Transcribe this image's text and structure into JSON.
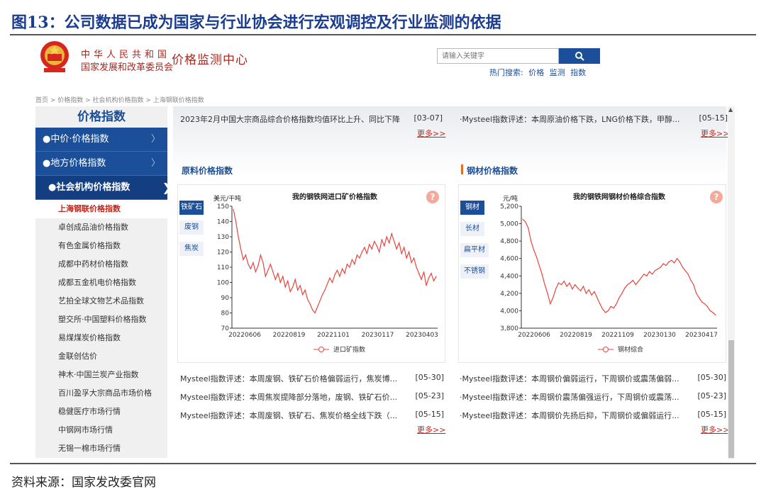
{
  "figure": {
    "title": "图13：公司数据已成为国家与行业协会进行宏观调控及行业监测的依据",
    "source": "资料来源：国家发改委官网"
  },
  "header": {
    "org_line1": "中华人民共和国",
    "org_line2": "国家发展和改革委员会",
    "center_name": "价格监测中心",
    "search_placeholder": "请输入关键字",
    "hot_label": "热门搜索:",
    "hot_terms": [
      "价格",
      "监测",
      "指数"
    ]
  },
  "breadcrumb": "首页 > 价格指数 > 社会机构价格指数 > 上海钢联价格指数",
  "sidebar": {
    "title": "价格指数",
    "sections": [
      "●中价·价格指数",
      "●地方价格指数",
      "●社会机构价格指数"
    ],
    "items": [
      "上海钢联价格指数",
      "卓创成品油价格指数",
      "有色金属价格指数",
      "成都中药材价格指数",
      "成都五金机电价格指数",
      "艺拍全球文物艺术品指数",
      "塑交所·中国塑料价格指数",
      "易煤煤炭价格指数",
      "金联创估价",
      "神木·中国兰炭产业指数",
      "百川盈孚大宗商品市场价格",
      "稳健医疗市场行情",
      "中钢网市场行情",
      "无锡一棉市场行情"
    ]
  },
  "top_news": {
    "left": {
      "text": "2023年2月中国大宗商品综合价格指数均值环比上升、同比下降",
      "date": "[03-07]"
    },
    "right": {
      "text": "·Mysteel指数评述：本周原油价格下跌，LNG价格下跌，甲醇...",
      "date": "[05-15]"
    },
    "more": "更多>>"
  },
  "raw_section": {
    "title": "原料价格指数",
    "tabs": [
      "铁矿石",
      "废钢",
      "焦炭"
    ],
    "chart_title": "我的钢铁网进口矿价格指数",
    "unit": "美元/干吨",
    "legend": "进口矿指数",
    "news": [
      {
        "text": "Mysteel指数评述：本周废钢、铁矿石价格偏弱运行，焦炭博...",
        "date": "[05-30]"
      },
      {
        "text": "Mysteel指数评述：本周焦炭提降部分落地，废钢、铁矿石价...",
        "date": "[05-23]"
      },
      {
        "text": "Mysteel指数评述：本周废钢、铁矿石、焦炭价格全线下跌（...",
        "date": "[05-15]"
      }
    ],
    "more": "更多>>"
  },
  "steel_section": {
    "title": "钢材价格指数",
    "tabs": [
      "钢材",
      "长材",
      "扁平材",
      "不锈钢"
    ],
    "chart_title": "我的钢铁网钢材价格综合指数",
    "unit": "元/吨",
    "legend": "钢材综合",
    "news": [
      {
        "text": "·Mysteel指数评述：本周钢价偏弱运行，下周钢价或震荡偏弱...",
        "date": "[05-30]"
      },
      {
        "text": "·Mysteel指数评述：本周钢价震荡偏强运行，下周钢价或震荡...",
        "date": "[05-23]"
      },
      {
        "text": "·Mysteel指数评述：本周钢价先扬后抑，下周钢价或偏弱运行...",
        "date": "[05-15]"
      }
    ],
    "more": "更多>>"
  },
  "colors": {
    "line": "#e8453c",
    "brand_blue": "#1b4f99",
    "brand_red": "#b1261d"
  },
  "chart_data": [
    {
      "type": "line",
      "title": "我的钢铁网进口矿价格指数",
      "ylabel": "美元/干吨",
      "ylim": [
        70,
        150
      ],
      "yticks": [
        70,
        80,
        90,
        100,
        110,
        120,
        130,
        140,
        150
      ],
      "xtick_labels": [
        "20220606",
        "20220819",
        "20221101",
        "20230117",
        "20230403"
      ],
      "series": [
        {
          "name": "进口矿指数",
          "values": [
            148,
            140,
            130,
            122,
            115,
            118,
            112,
            109,
            113,
            107,
            111,
            118,
            113,
            104,
            108,
            112,
            107,
            102,
            106,
            100,
            104,
            97,
            101,
            94,
            97,
            102,
            95,
            98,
            92,
            95,
            89,
            86,
            82,
            80,
            84,
            88,
            92,
            95,
            99,
            103,
            100,
            105,
            108,
            104,
            109,
            106,
            112,
            110,
            115,
            112,
            118,
            116,
            120,
            123,
            119,
            125,
            122,
            127,
            124,
            120,
            128,
            124,
            130,
            126,
            132,
            127,
            122,
            126,
            119,
            123,
            116,
            120,
            113,
            116,
            110,
            106,
            102,
            107,
            98,
            103,
            106,
            101,
            104
          ]
        }
      ],
      "grid": false,
      "legend_position": "bottom"
    },
    {
      "type": "line",
      "title": "我的钢铁网钢材价格综合指数",
      "ylabel": "元/吨",
      "ylim": [
        3800,
        5200
      ],
      "yticks": [
        3800,
        4000,
        4200,
        4400,
        4600,
        4800,
        5000,
        5200
      ],
      "xtick_labels": [
        "20220606",
        "20220819",
        "20221109",
        "20230130",
        "20230417"
      ],
      "series": [
        {
          "name": "钢材综合",
          "values": [
            5050,
            5020,
            4950,
            4800,
            4700,
            4620,
            4520,
            4420,
            4300,
            4200,
            4080,
            4150,
            4250,
            4320,
            4300,
            4340,
            4280,
            4320,
            4250,
            4300,
            4260,
            4230,
            4280,
            4200,
            4240,
            4180,
            4220,
            4150,
            4080,
            4020,
            3980,
            4000,
            4050,
            4030,
            4080,
            4150,
            4200,
            4260,
            4300,
            4320,
            4350,
            4300,
            4340,
            4380,
            4420,
            4400,
            4450,
            4420,
            4460,
            4480,
            4500,
            4540,
            4520,
            4560,
            4580,
            4550,
            4600,
            4560,
            4500,
            4460,
            4420,
            4350,
            4300,
            4200,
            4150,
            4100,
            4080,
            4050,
            4000,
            3980,
            3950
          ]
        }
      ],
      "grid": false,
      "legend_position": "bottom"
    }
  ]
}
